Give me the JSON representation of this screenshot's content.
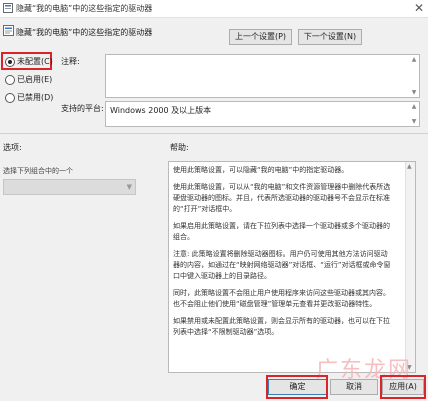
{
  "window": {
    "title": "隐藏“我的电脑”中的这些指定的驱动器",
    "close_glyph": "✕"
  },
  "header": {
    "policy_name": "隐藏“我的电脑”中的这些指定的驱动器",
    "prev_button": "上一个设置(P)",
    "next_button": "下一个设置(N)"
  },
  "state": {
    "options": [
      {
        "label": "未配置(C)",
        "checked": true
      },
      {
        "label": "已启用(E)",
        "checked": false
      },
      {
        "label": "已禁用(D)",
        "checked": false
      }
    ],
    "comment_label": "注释:",
    "platform_label": "支持的平台:",
    "platform_value": "Windows 2000 及以上版本"
  },
  "options_pane": {
    "title": "选项:",
    "dropdown_label": "选择下列组合中的一个"
  },
  "help_pane": {
    "title": "帮助:",
    "paragraphs": [
      "使用此策略设置，可以隐藏“我的电脑”中的指定驱动器。",
      "使用此策略设置，可以从“我的电脑”和文件资源管理器中删除代表所选硬盘驱动器的图标。并且，代表所选驱动器的驱动器号不会显示在标准的“打开”对话框中。",
      "如果启用此策略设置，请在下拉列表中选择一个驱动器或多个驱动器的组合。",
      "注意: 此策略设置将删除驱动器图标。用户仍可使用其他方法访问驱动器的内容，如通过在“映射网络驱动器”对话框、“运行”对话框或命令窗口中键入驱动器上的目录路径。",
      "同时，此策略设置不会阻止用户使用程序来访问这些驱动器或其内容。也不会阻止他们使用“磁盘管理”管理单元查看并更改驱动器特性。",
      "如果禁用或未配置此策略设置，则会显示所有的驱动器，也可以在下拉列表中选择“不限制驱动器”选项。"
    ]
  },
  "footer": {
    "ok_button": "确定",
    "cancel_button": "取消",
    "apply_button": "应用(A)"
  },
  "watermark": "广东龙网"
}
